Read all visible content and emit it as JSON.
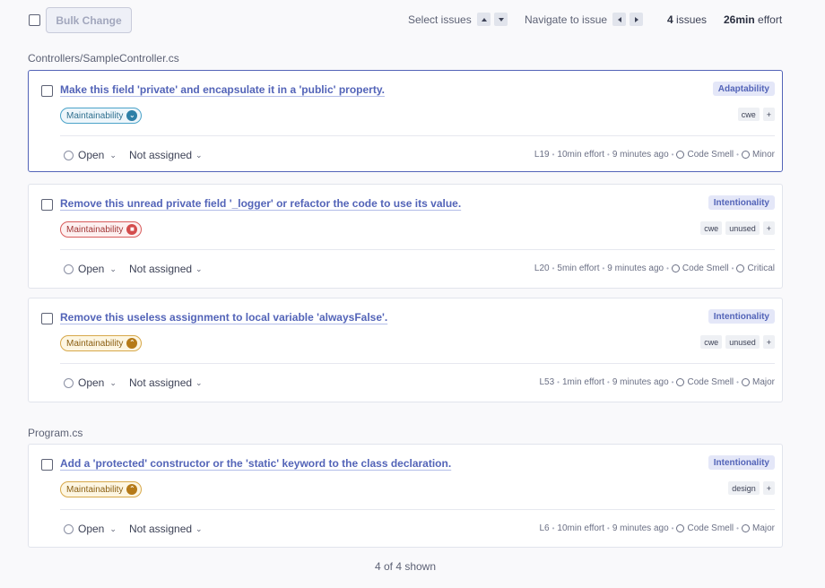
{
  "toolbar": {
    "bulk_change": "Bulk Change",
    "select_issues": "Select issues",
    "navigate_to_issue": "Navigate to issue",
    "issues_count": "4",
    "issues_label": "issues",
    "effort_value": "26min",
    "effort_label": "effort"
  },
  "groups": [
    {
      "file": "Controllers/SampleController.cs",
      "issues": [
        {
          "title": "Make this field 'private' and encapsulate it in a 'public' property.",
          "attribute": "Adaptability",
          "quality": "Maintainability",
          "severity_icon": "severity-low-icon",
          "tags": [
            "cwe",
            "+"
          ],
          "status": "Open",
          "assignee": "Not assigned",
          "line": "L19",
          "effort": "10min effort",
          "time": "9 minutes ago",
          "type": "Code Smell",
          "severity": "Minor"
        },
        {
          "title": "Remove this unread private field '_logger' or refactor the code to use its value.",
          "attribute": "Intentionality",
          "quality": "Maintainability",
          "severity_icon": "severity-high-icon",
          "tags": [
            "cwe",
            "unused",
            "+"
          ],
          "status": "Open",
          "assignee": "Not assigned",
          "line": "L20",
          "effort": "5min effort",
          "time": "9 minutes ago",
          "type": "Code Smell",
          "severity": "Critical"
        },
        {
          "title": "Remove this useless assignment to local variable 'alwaysFalse'.",
          "attribute": "Intentionality",
          "quality": "Maintainability",
          "severity_icon": "severity-medium-icon",
          "tags": [
            "cwe",
            "unused",
            "+"
          ],
          "status": "Open",
          "assignee": "Not assigned",
          "line": "L53",
          "effort": "1min effort",
          "time": "9 minutes ago",
          "type": "Code Smell",
          "severity": "Major"
        }
      ]
    },
    {
      "file": "Program.cs",
      "issues": [
        {
          "title": "Add a 'protected' constructor or the 'static' keyword to the class declaration.",
          "attribute": "Intentionality",
          "quality": "Maintainability",
          "severity_icon": "severity-medium-icon",
          "tags": [
            "design",
            "+"
          ],
          "status": "Open",
          "assignee": "Not assigned",
          "line": "L6",
          "effort": "10min effort",
          "time": "9 minutes ago",
          "type": "Code Smell",
          "severity": "Major"
        }
      ]
    }
  ],
  "footer": {
    "shown": "4 of 4 shown"
  },
  "colors": {
    "accent": "#5364b8",
    "low": "#2e7fa7",
    "high": "#d44c4c",
    "medium": "#b57a18"
  }
}
